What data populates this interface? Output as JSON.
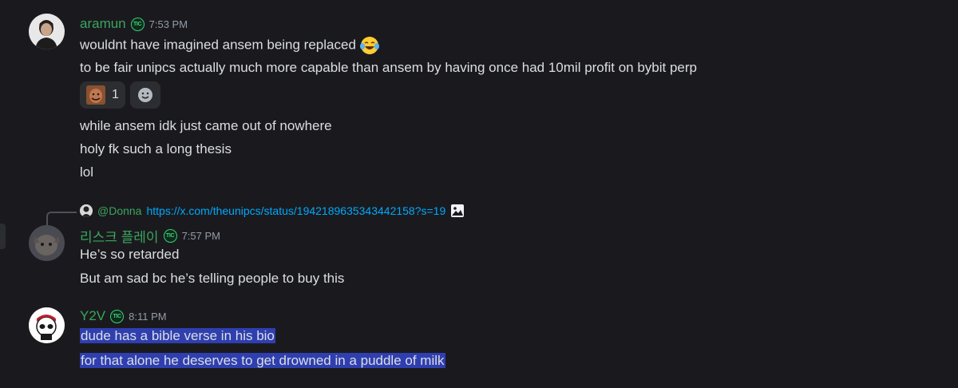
{
  "messages": [
    {
      "username": "aramun",
      "username_color": "#3ba55d",
      "badge": "TIC",
      "timestamp": "7:53 PM",
      "lines": [
        "wouldnt have imagined ansem being replaced",
        "to be fair unipcs actually much more capable than ansem by having once had 10mil profit on bybit perp"
      ],
      "first_line_emoji": "face-with-tears-of-joy-icon",
      "reaction": {
        "emoji": "custom-face-emoji-icon",
        "count": "1"
      },
      "more_lines": [
        "while ansem idk just came out of nowhere",
        "holy fk such a long thesis",
        "lol"
      ]
    },
    {
      "reply": {
        "user": "@Donna",
        "link": "https://x.com/theunipcs/status/1942189635343442158?s=19"
      },
      "username": "리스크 플레이",
      "username_color": "#3ba55d",
      "badge": "TIC",
      "timestamp": "7:57 PM",
      "lines": [
        "He’s so retarded",
        "But am sad bc he’s telling people to buy this"
      ]
    },
    {
      "username": "Y2V",
      "username_color": "#3ba55d",
      "badge": "TIC",
      "timestamp": "8:11 PM",
      "lines": [
        "dude has a bible verse in his bio",
        "for that alone he deserves to get drowned in a puddle of milk"
      ],
      "highlight_color": "#2f3fb0"
    }
  ]
}
